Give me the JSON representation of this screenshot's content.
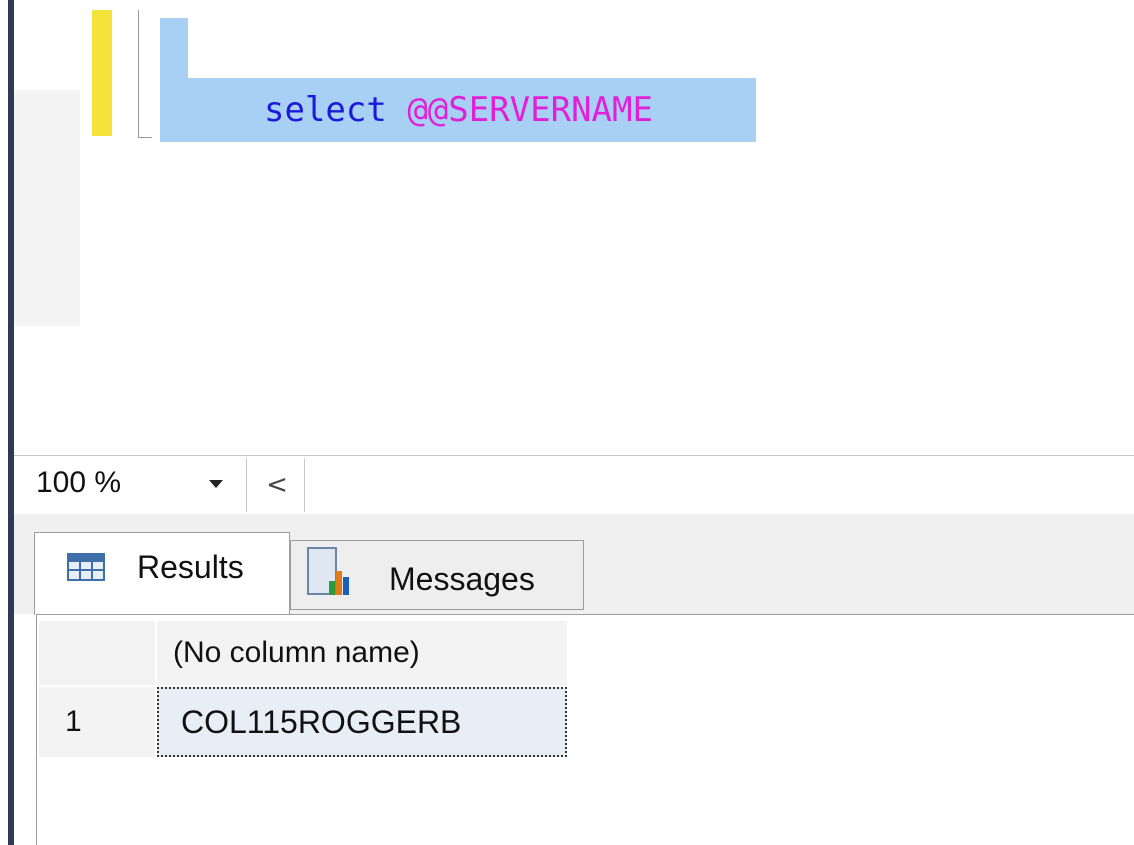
{
  "editor": {
    "query_keyword": "select",
    "query_variable": "@@SERVERNAME"
  },
  "zoom": {
    "value": "100 %",
    "scroll_left_glyph": "<"
  },
  "results": {
    "tabs": [
      {
        "label": "Results",
        "icon": "grid-icon",
        "active": true
      },
      {
        "label": "Messages",
        "icon": "messages-icon",
        "active": false
      }
    ],
    "columns": [
      "(No column name)"
    ],
    "rows": [
      {
        "num": "1",
        "values": [
          "COL115ROGGERB"
        ]
      }
    ]
  },
  "colors": {
    "keyword": "#1a1ad8",
    "system_variable": "#e020d8",
    "selection": "#a8d0f5",
    "change_bar": "#f5e23a"
  }
}
